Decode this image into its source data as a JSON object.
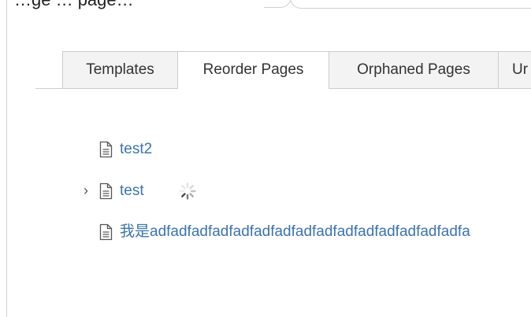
{
  "header": {
    "cut_off_text": "…ge    … page…"
  },
  "tabs": [
    {
      "label": "Templates",
      "active": false
    },
    {
      "label": "Reorder Pages",
      "active": true
    },
    {
      "label": "Orphaned Pages",
      "active": false
    },
    {
      "label": "Ur",
      "active": false
    }
  ],
  "tree": {
    "items": [
      {
        "title": "test2",
        "expandable": false,
        "loading": false,
        "icon": "page-icon"
      },
      {
        "title": "test",
        "expandable": true,
        "loading": true,
        "icon": "page-icon",
        "chevron": "›"
      },
      {
        "title": "我是adfadfadfadfadfadfadfadfadfadfadfadfadfadfadfa",
        "expandable": false,
        "loading": false,
        "icon": "page-icon"
      }
    ]
  },
  "colors": {
    "link": "#3b73af",
    "tab_border": "#cccccc",
    "tab_inactive_bg": "#f3f3f3",
    "text": "#333333"
  }
}
